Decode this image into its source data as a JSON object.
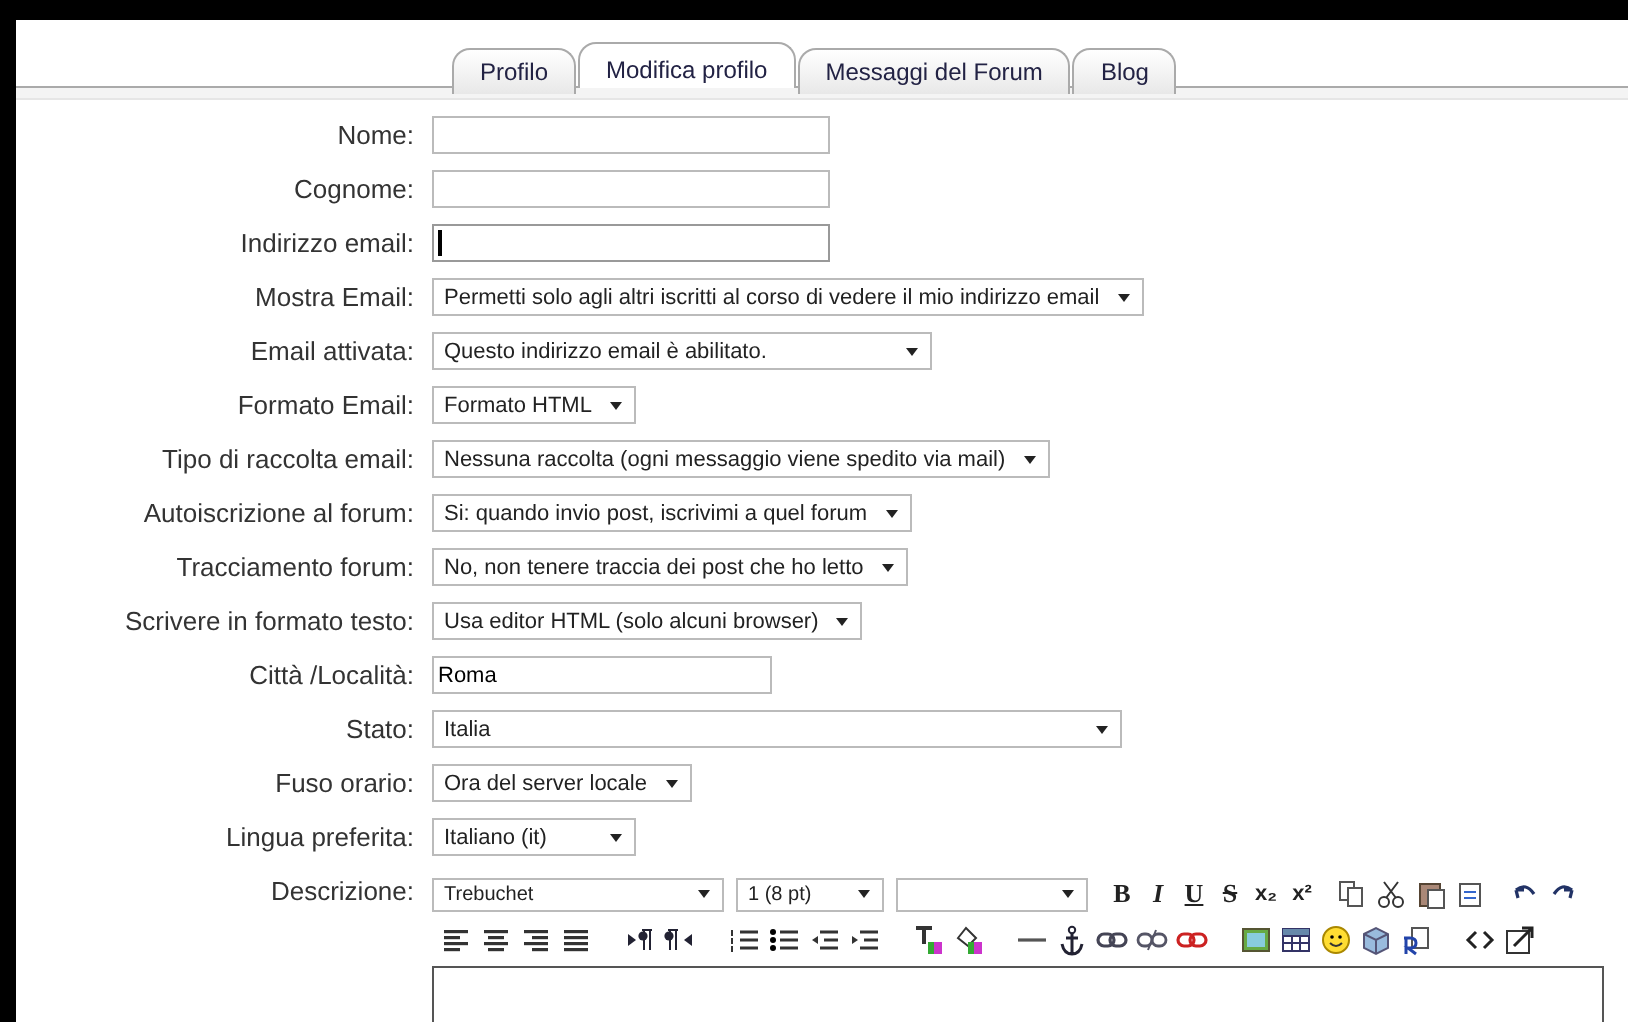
{
  "tabs": [
    {
      "label": "Profilo",
      "selected": false
    },
    {
      "label": "Modifica profilo",
      "selected": true
    },
    {
      "label": "Messaggi del Forum",
      "selected": false
    },
    {
      "label": "Blog",
      "selected": false
    }
  ],
  "fields": [
    {
      "label": "Nome:",
      "kind": "text",
      "focused": false
    },
    {
      "label": "Cognome:",
      "kind": "text",
      "focused": false
    },
    {
      "label": "Indirizzo email:",
      "kind": "text",
      "focused": true
    },
    {
      "label": "Mostra Email:",
      "kind": "select",
      "value": "Permetti solo agli altri iscritti al corso di vedere il mio indirizzo email"
    },
    {
      "label": "Email attivata:",
      "kind": "select",
      "value": "Questo indirizzo email è abilitato."
    },
    {
      "label": "Formato Email:",
      "kind": "select",
      "value": "Formato HTML"
    },
    {
      "label": "Tipo di raccolta email:",
      "kind": "select",
      "value": "Nessuna raccolta (ogni messaggio viene spedito via mail)"
    },
    {
      "label": "Autoiscrizione al forum:",
      "kind": "select",
      "value": "Si: quando invio post, iscrivimi a quel forum"
    },
    {
      "label": "Tracciamento forum:",
      "kind": "select",
      "value": "No, non tenere traccia dei post che ho letto"
    },
    {
      "label": "Scrivere in formato testo:",
      "kind": "select",
      "value": "Usa editor HTML (solo alcuni browser)"
    },
    {
      "label": "Città /Località:",
      "kind": "text",
      "value": "Roma",
      "focused": false
    },
    {
      "label": "Stato:",
      "kind": "select",
      "value": "Italia"
    },
    {
      "label": "Fuso orario:",
      "kind": "select",
      "value": "Ora del server locale"
    },
    {
      "label": "Lingua preferita:",
      "kind": "select",
      "value": "Italiano (it)"
    },
    {
      "label": "Descrizione:",
      "kind": "editor"
    }
  ],
  "editor": {
    "font": "Trebuchet",
    "size": "1 (8 pt)",
    "format_buttons": [
      {
        "text": "B",
        "kind": "bold"
      },
      {
        "text": "I",
        "kind": "italic"
      },
      {
        "text": "U",
        "kind": "underline"
      },
      {
        "text": "S",
        "kind": "strike"
      },
      {
        "text": "x₂",
        "kind": "plain"
      },
      {
        "text": "x²",
        "kind": "plain"
      }
    ]
  }
}
